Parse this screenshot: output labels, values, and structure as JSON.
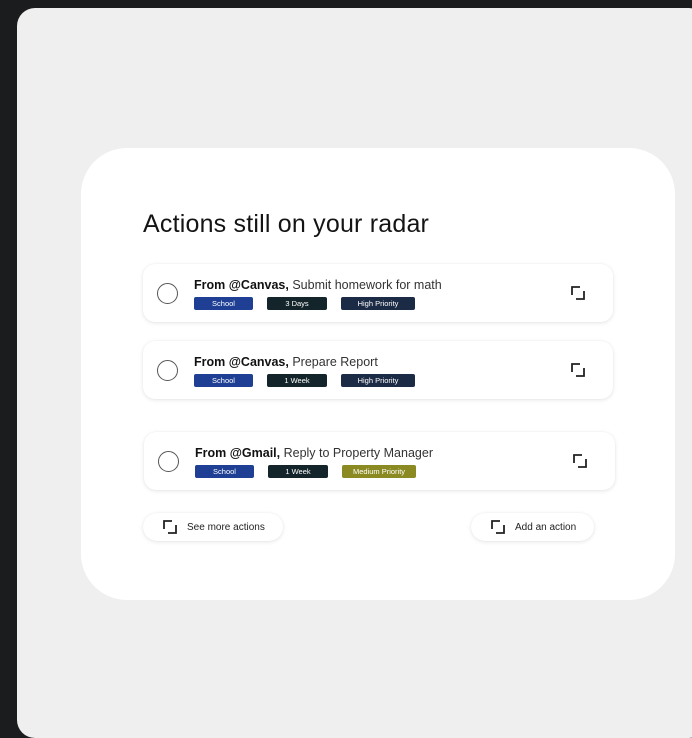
{
  "card": {
    "title": "Actions still on your radar"
  },
  "colors": {
    "school": "#1e3f93",
    "time": "#13252a",
    "high": "#1b2a45",
    "medium": "#8b8a22"
  },
  "actions": [
    {
      "source": "From @Canvas,",
      "text": " Submit homework for math",
      "tags": {
        "category": "School",
        "time": "3 Days",
        "priority": "High Priority"
      },
      "priority_level": "high"
    },
    {
      "source": "From @Canvas,",
      "text": " Prepare Report",
      "tags": {
        "category": "School",
        "time": "1 Week",
        "priority": "High Priority"
      },
      "priority_level": "high"
    },
    {
      "source": "From @Gmail,",
      "text": " Reply to Property Manager",
      "tags": {
        "category": "School",
        "time": "1 Week",
        "priority": "Medium Priority"
      },
      "priority_level": "medium"
    }
  ],
  "buttons": {
    "see_more": "See more actions",
    "add_action": "Add an action"
  },
  "icons": {
    "row_action": "expand-corner-icon",
    "see_more": "expand-corner-icon",
    "add_action": "expand-corner-icon"
  }
}
